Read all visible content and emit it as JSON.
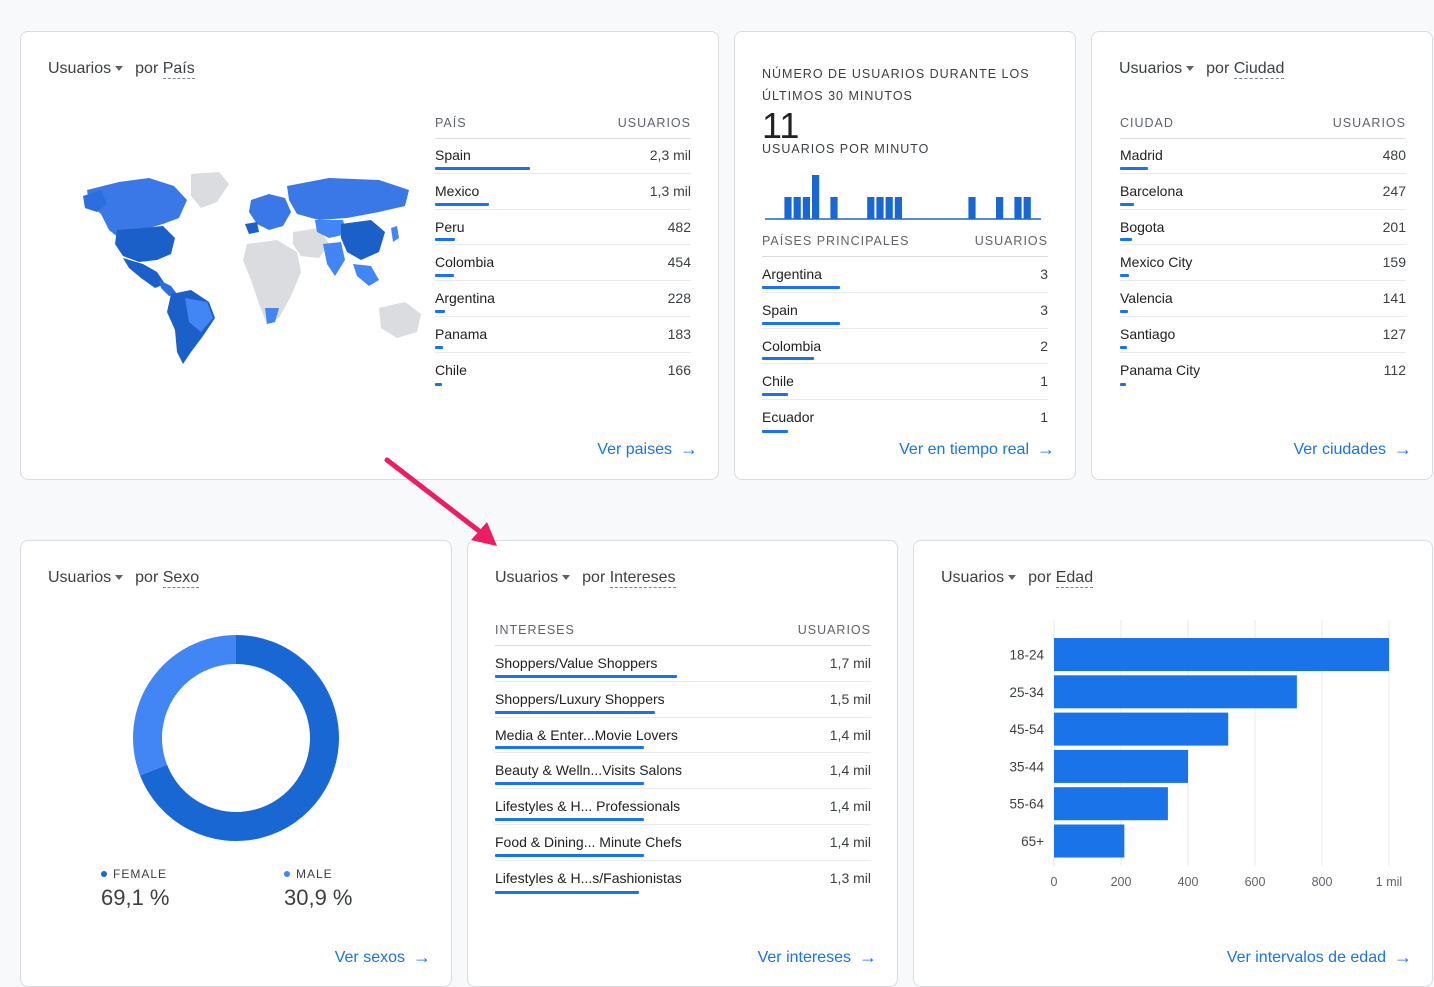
{
  "colors": {
    "accent": "#1a73e8",
    "female": "#1967d2",
    "male": "#4285f4",
    "annotation_arrow": "#e91e63"
  },
  "country_card": {
    "metric": "Usuarios",
    "by": "por",
    "dimension": "País",
    "col_name": "PAÍS",
    "col_value": "USUARIOS",
    "rows": [
      {
        "label": "Spain",
        "value": "2,3 mil",
        "share": 1.0
      },
      {
        "label": "Mexico",
        "value": "1,3 mil",
        "share": 0.57
      },
      {
        "label": "Peru",
        "value": "482",
        "share": 0.21
      },
      {
        "label": "Colombia",
        "value": "454",
        "share": 0.2
      },
      {
        "label": "Argentina",
        "value": "228",
        "share": 0.1
      },
      {
        "label": "Panama",
        "value": "183",
        "share": 0.08
      },
      {
        "label": "Chile",
        "value": "166",
        "share": 0.07
      }
    ],
    "link": "Ver paises"
  },
  "realtime_card": {
    "title_line1": "NÚMERO DE USUARIOS DURANTE LOS",
    "title_line2": "ÚLTIMOS 30 MINUTOS",
    "total": "11",
    "per_minute_label": "USUARIOS POR MINUTO",
    "per_minute_values": [
      0,
      0,
      1,
      1,
      1,
      2,
      0,
      1,
      0,
      0,
      0,
      1,
      1,
      1,
      1,
      0,
      0,
      0,
      0,
      0,
      0,
      0,
      1,
      0,
      0,
      1,
      0,
      1,
      1,
      0
    ],
    "col_name": "PAÍSES PRINCIPALES",
    "col_value": "USUARIOS",
    "rows": [
      {
        "label": "Argentina",
        "value": "3",
        "share": 1.0
      },
      {
        "label": "Spain",
        "value": "3",
        "share": 1.0
      },
      {
        "label": "Colombia",
        "value": "2",
        "share": 0.67
      },
      {
        "label": "Chile",
        "value": "1",
        "share": 0.33
      },
      {
        "label": "Ecuador",
        "value": "1",
        "share": 0.33
      }
    ],
    "link": "Ver en tiempo real"
  },
  "city_card": {
    "metric": "Usuarios",
    "by": "por",
    "dimension": "Ciudad",
    "col_name": "CIUDAD",
    "col_value": "USUARIOS",
    "rows": [
      {
        "label": "Madrid",
        "value": "480",
        "share": 1.0
      },
      {
        "label": "Barcelona",
        "value": "247",
        "share": 0.51
      },
      {
        "label": "Bogota",
        "value": "201",
        "share": 0.42
      },
      {
        "label": "Mexico City",
        "value": "159",
        "share": 0.33
      },
      {
        "label": "Valencia",
        "value": "141",
        "share": 0.29
      },
      {
        "label": "Santiago",
        "value": "127",
        "share": 0.26
      },
      {
        "label": "Panama City",
        "value": "112",
        "share": 0.23
      }
    ],
    "link": "Ver ciudades"
  },
  "gender_card": {
    "metric": "Usuarios",
    "by": "por",
    "dimension": "Sexo",
    "female_label": "FEMALE",
    "female_value": "69,1 %",
    "female_share": 0.691,
    "male_label": "MALE",
    "male_value": "30,9 %",
    "male_share": 0.309,
    "link": "Ver sexos"
  },
  "interests_card": {
    "metric": "Usuarios",
    "by": "por",
    "dimension": "Intereses",
    "col_name": "INTERESES",
    "col_value": "USUARIOS",
    "rows": [
      {
        "label": "Shoppers/Value Shoppers",
        "value": "1,7 mil",
        "share": 1.0
      },
      {
        "label": "Shoppers/Luxury Shoppers",
        "value": "1,5 mil",
        "share": 0.88
      },
      {
        "label": "Media & Enter...Movie Lovers",
        "value": "1,4 mil",
        "share": 0.82
      },
      {
        "label": "Beauty & Welln...Visits Salons",
        "value": "1,4 mil",
        "share": 0.82
      },
      {
        "label": "Lifestyles & H... Professionals",
        "value": "1,4 mil",
        "share": 0.82
      },
      {
        "label": "Food & Dining... Minute Chefs",
        "value": "1,4 mil",
        "share": 0.82
      },
      {
        "label": "Lifestyles & H...s/Fashionistas",
        "value": "1,3 mil",
        "share": 0.79
      }
    ],
    "link": "Ver intereses"
  },
  "age_card": {
    "metric": "Usuarios",
    "by": "por",
    "dimension": "Edad",
    "link": "Ver intervalos de edad"
  },
  "chart_data": {
    "type": "bar",
    "orientation": "horizontal",
    "categories": [
      "18-24",
      "25-34",
      "45-54",
      "35-44",
      "55-64",
      "65+"
    ],
    "values": [
      1000,
      725,
      520,
      400,
      340,
      210
    ],
    "xlim": [
      0,
      1000
    ],
    "xticks": [
      {
        "v": 0,
        "label": "0"
      },
      {
        "v": 200,
        "label": "200"
      },
      {
        "v": 400,
        "label": "400"
      },
      {
        "v": 600,
        "label": "600"
      },
      {
        "v": 800,
        "label": "800"
      },
      {
        "v": 1000,
        "label": "1 mil"
      }
    ],
    "grid": true
  }
}
